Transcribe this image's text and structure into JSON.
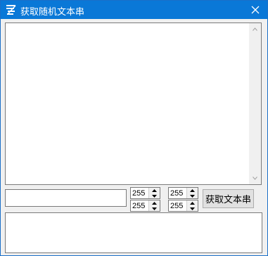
{
  "window": {
    "title": "获取随机文本串",
    "app_icon": "app-logo-icon",
    "close_icon": "close-icon"
  },
  "main_text": {
    "value": ""
  },
  "line_input": {
    "value": ""
  },
  "spinners": [
    {
      "value": "255"
    },
    {
      "value": "255"
    },
    {
      "value": "255"
    },
    {
      "value": "255"
    }
  ],
  "get_button": {
    "label": "获取文本串"
  },
  "output": {
    "value": ""
  },
  "colors": {
    "titlebar": "#0a78d7",
    "window_bg": "#f0f0f0",
    "button_bg": "#e1e1e1"
  }
}
